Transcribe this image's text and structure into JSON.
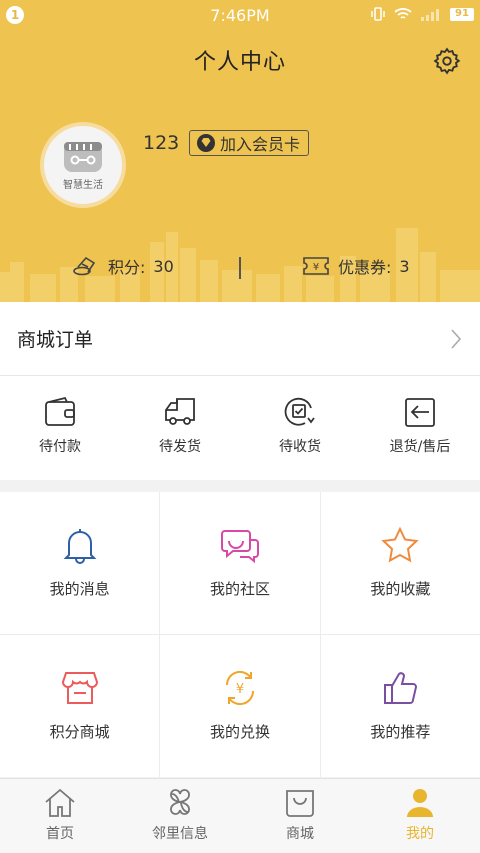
{
  "status_bar": {
    "time": "7:46PM",
    "battery": "91",
    "notification_badge": "1"
  },
  "header": {
    "title": "个人中心",
    "avatar_text": "智慧生活",
    "username": "123",
    "member_card_label": "加入会员卡",
    "points_label": "积分:",
    "points_value": "30",
    "coupons_label": "优惠券:",
    "coupons_value": "3",
    "background_color": "#eec34f"
  },
  "orders": {
    "title": "商城订单",
    "items": [
      {
        "label": "待付款",
        "icon": "wallet-icon"
      },
      {
        "label": "待发货",
        "icon": "truck-icon"
      },
      {
        "label": "待收货",
        "icon": "receive-icon"
      },
      {
        "label": "退货/售后",
        "icon": "return-icon"
      }
    ]
  },
  "menu": {
    "items": [
      {
        "label": "我的消息",
        "icon": "bell-icon",
        "color": "#2f5fa8"
      },
      {
        "label": "我的社区",
        "icon": "chat-bubbles-icon",
        "color": "#d64aa6"
      },
      {
        "label": "我的收藏",
        "icon": "star-icon",
        "color": "#f08a3c"
      },
      {
        "label": "积分商城",
        "icon": "shop-icon",
        "color": "#ec5a5a"
      },
      {
        "label": "我的兑换",
        "icon": "exchange-icon",
        "color": "#f0a52a"
      },
      {
        "label": "我的推荐",
        "icon": "thumbs-up-icon",
        "color": "#7a4fa0"
      }
    ]
  },
  "bottom_nav": {
    "items": [
      {
        "label": "首页",
        "icon": "home-icon"
      },
      {
        "label": "邻里信息",
        "icon": "clover-icon"
      },
      {
        "label": "商城",
        "icon": "shopping-bag-icon"
      },
      {
        "label": "我的",
        "icon": "person-icon"
      }
    ],
    "active_index": 3,
    "active_color": "#e8b52f"
  }
}
